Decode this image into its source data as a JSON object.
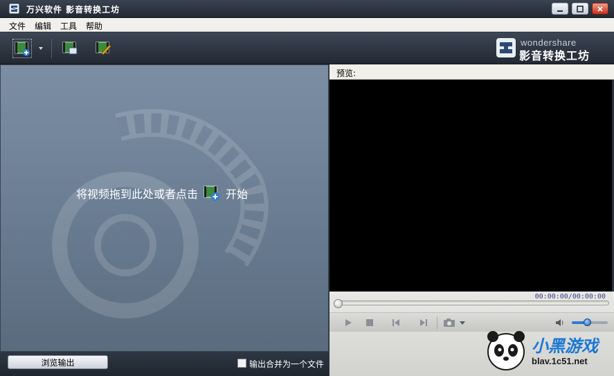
{
  "window": {
    "title": "万兴软件 影音转换工坊",
    "controls": [
      "minimize-icon",
      "maximize-icon",
      "close-icon"
    ]
  },
  "menu": [
    "文件",
    "编辑",
    "工具",
    "帮助"
  ],
  "toolbar": {
    "icons": [
      "add-video-icon",
      "chevron-down-icon",
      "convert-settings-icon",
      "edit-video-icon"
    ]
  },
  "brand": {
    "en": "wondershare",
    "cn": "影音转换工坊"
  },
  "left_pane": {
    "drop_hint_before": "将视频拖到此处或者点击",
    "drop_hint_after": "开始",
    "browse_button": "浏览输出",
    "merge_label": "输出合并为一个文件",
    "merge_checked": false
  },
  "preview": {
    "label": "预览:",
    "timecode": "00:00:00/00:00:00",
    "seek_position": 0,
    "volume_level": 0.45,
    "control_icons": [
      "play-icon",
      "stop-icon",
      "previous-icon",
      "next-icon",
      "snapshot-icon",
      "volume-icon"
    ]
  },
  "watermark": {
    "text": "小黑游戏",
    "sub": "blav.1c51.net"
  },
  "colors": {
    "titlebar": "#2b3340",
    "left_pane": "#6e8197",
    "video_bg": "#000000",
    "accent": "#2e7bd6"
  }
}
